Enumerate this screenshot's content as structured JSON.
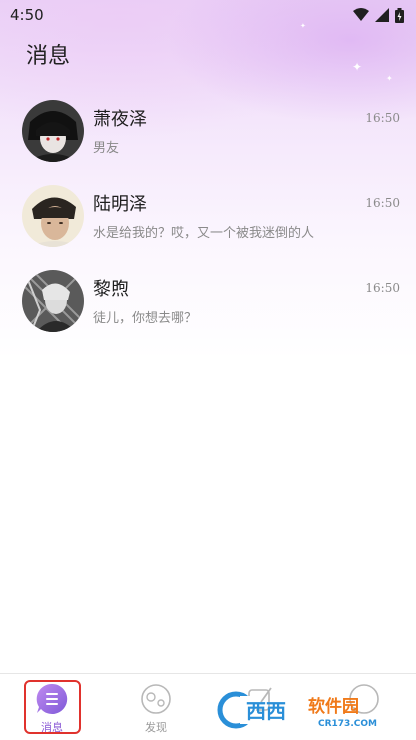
{
  "status_bar": {
    "time": "4:50",
    "icons": [
      "wifi-icon",
      "signal-icon",
      "battery-icon"
    ]
  },
  "header": {
    "title": "消息"
  },
  "chats": [
    {
      "name": "萧夜泽",
      "preview": "男友",
      "time": "16:50"
    },
    {
      "name": "陆明泽",
      "preview": "水是给我的？哎，又一个被我迷倒的人",
      "time": "16:50"
    },
    {
      "name": "黎煦",
      "preview": "徒儿，你想去哪？",
      "time": "16:50"
    }
  ],
  "tabs": [
    {
      "label": "消息",
      "icon": "chat-icon",
      "active": true
    },
    {
      "label": "发现",
      "icon": "discover-icon",
      "active": false
    },
    {
      "label": "",
      "icon": "edit-icon",
      "active": false
    },
    {
      "label": "",
      "icon": "profile-icon",
      "active": false
    }
  ],
  "watermark": {
    "text": "西西软件园",
    "sub": "CR173.COM"
  },
  "colors": {
    "accent": "#8b5ad6",
    "highlight_border": "#e0322d",
    "watermark_blue": "#2a8fd8",
    "watermark_orange": "#f07a1a"
  }
}
